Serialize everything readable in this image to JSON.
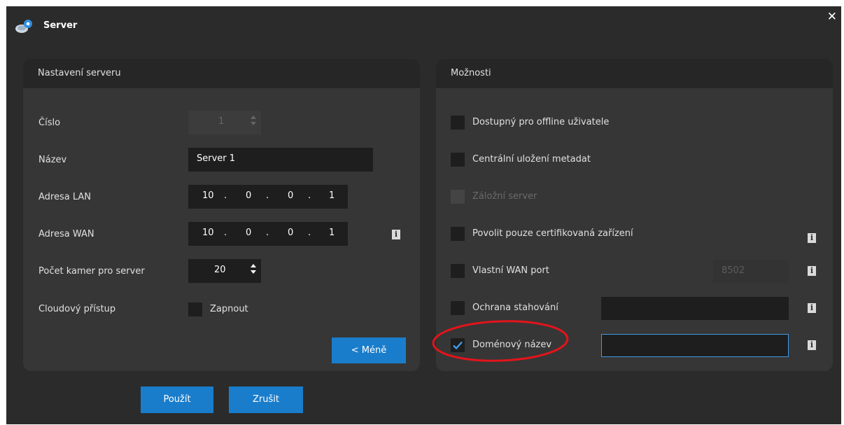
{
  "window": {
    "title": "Server",
    "close_symbol": "✕"
  },
  "left_panel": {
    "title": "Nastavení serveru",
    "number": {
      "label": "Číslo",
      "value": "1"
    },
    "name": {
      "label": "Název",
      "value": "Server 1"
    },
    "lan": {
      "label": "Adresa LAN",
      "octets": [
        "10",
        "0",
        "0",
        "1"
      ]
    },
    "wan": {
      "label": "Adresa WAN",
      "octets": [
        "10",
        "0",
        "0",
        "1"
      ]
    },
    "cameras": {
      "label": "Počet kamer pro server",
      "value": "20"
    },
    "cloud": {
      "label": "Cloudový přístup",
      "checkbox_label": "Zapnout",
      "checked": false
    },
    "less_button": "< Méně",
    "ip_dot": "."
  },
  "right_panel": {
    "title": "Možnosti",
    "options": [
      {
        "label": "Dostupný pro offline uživatele",
        "checked": false,
        "disabled": false
      },
      {
        "label": "Centrální uložení metadat",
        "checked": false,
        "disabled": false
      },
      {
        "label": "Záložní server",
        "checked": false,
        "disabled": true
      },
      {
        "label": "Povolit pouze certifikovaná zařízení",
        "checked": false,
        "disabled": false
      },
      {
        "label": "Vlastní WAN port",
        "checked": false,
        "disabled": false,
        "field_value": "8502"
      },
      {
        "label": "Ochrana stahování",
        "checked": false,
        "disabled": false,
        "field_value": ""
      },
      {
        "label": "Doménový název",
        "checked": true,
        "disabled": false,
        "field_value": ""
      }
    ]
  },
  "footer": {
    "apply": "Použít",
    "cancel": "Zrušit"
  },
  "info_glyph": "i",
  "colors": {
    "window_bg": "#2b2b2b",
    "panel_bg": "#363636",
    "panel_header": "#262626",
    "field_bg": "#1e1e1e",
    "accent": "#1a7dcb",
    "highlight": "#e3141b"
  },
  "icons": [
    "server-gear-icon",
    "close-icon",
    "info-icon",
    "checkmark-icon"
  ]
}
